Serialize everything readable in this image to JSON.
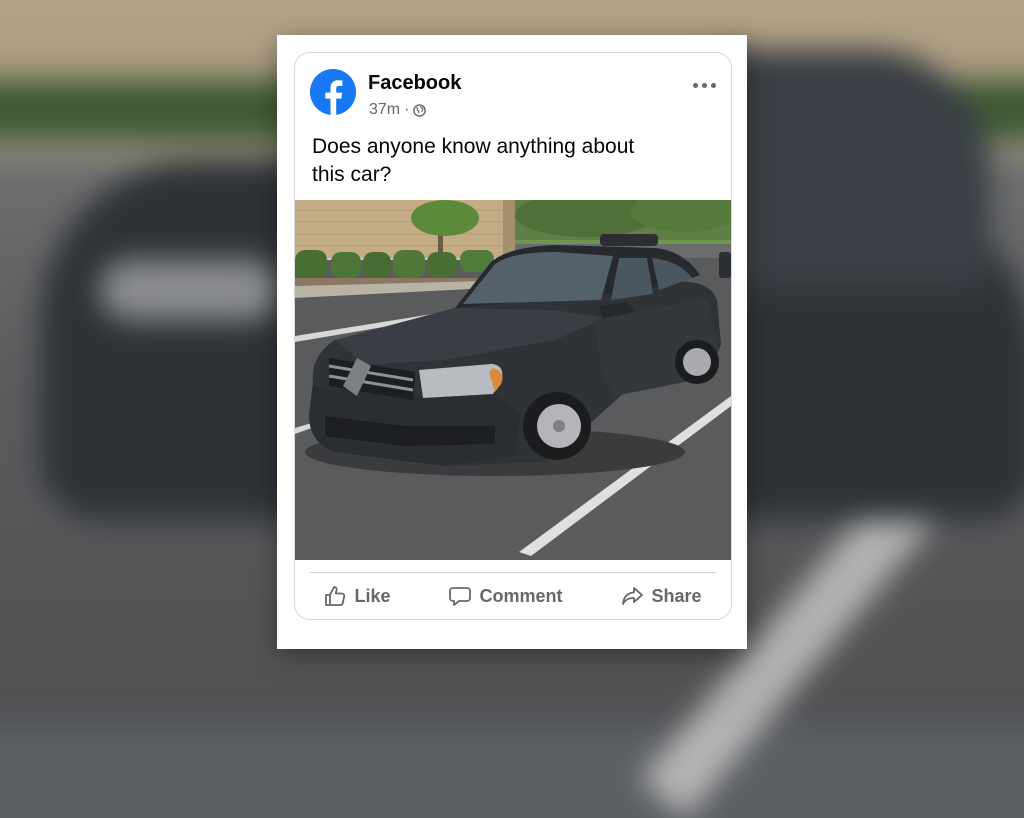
{
  "post": {
    "author": "Facebook",
    "time": "37m",
    "separator": "·",
    "text": "Does anyone know anything about this car?",
    "brand_color": "#1877f2"
  },
  "actions": {
    "like": "Like",
    "comment": "Comment",
    "share": "Share"
  },
  "icons": {
    "logo": "facebook-logo-icon",
    "audience": "globe-icon",
    "more": "more-options-icon",
    "like": "thumbs-up-icon",
    "comment": "speech-bubble-icon",
    "share": "share-arrow-icon"
  }
}
